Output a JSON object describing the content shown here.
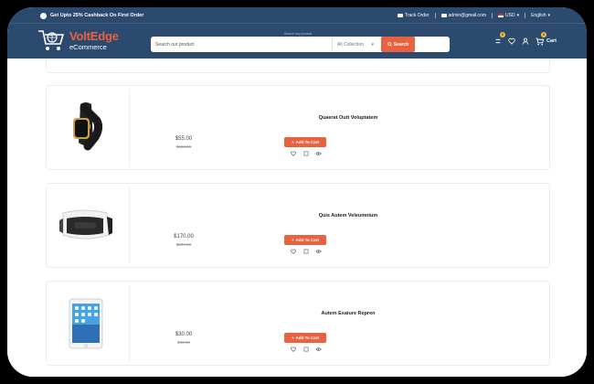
{
  "topbar": {
    "promo": "Get Upto 25% Cashback On First Order",
    "track_order": "Track Order",
    "email": "admin@gmail.com",
    "currency": "USD",
    "language": "English"
  },
  "brand": {
    "name": "VoltEdge",
    "tagline": "eCommerce"
  },
  "search": {
    "hint": "Search any product",
    "placeholder": "Search our product",
    "collection": "All Collection",
    "button": "Search"
  },
  "header_icons": {
    "compare_badge": "0",
    "cart_badge": "0",
    "cart_label": "Cart"
  },
  "products": [
    {
      "name": "Quaerat Outt Voluptatem",
      "price": "$55.00",
      "old_price": "$150.00",
      "add_to_cart": "Add To Cart",
      "image_icon": "smartwatch-icon"
    },
    {
      "name": "Quis Autem Veleumnium",
      "price": "$170.00",
      "old_price": "$200.00",
      "add_to_cart": "Add To Cart",
      "image_icon": "vr-headset-icon"
    },
    {
      "name": "Autem Exaiure Repren",
      "price": "$30.00",
      "old_price": "$40.00",
      "add_to_cart": "Add To Cart",
      "image_icon": "tablet-icon"
    }
  ],
  "colors": {
    "header": "#2b4a6e",
    "accent": "#e8623f",
    "badge": "#f0c040"
  }
}
